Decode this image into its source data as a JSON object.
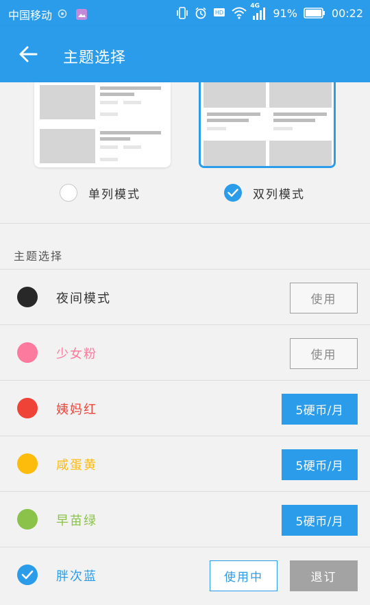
{
  "status_bar": {
    "carrier": "中国移动",
    "network": "4G",
    "battery": "91%",
    "time": "00:22"
  },
  "app_bar": {
    "back_icon": "arrow-left-icon",
    "title": "主题选择"
  },
  "layout_modes": [
    {
      "label": "单列模式",
      "selected": false
    },
    {
      "label": "双列模式",
      "selected": true
    }
  ],
  "section_title": "主题选择",
  "themes": [
    {
      "name": "夜间模式",
      "color": "#282828",
      "text_color": "#333333",
      "action": "使用",
      "action_type": "use"
    },
    {
      "name": "少女粉",
      "color": "#fb7a9e",
      "text_color": "#fb7a9e",
      "action": "使用",
      "action_type": "use"
    },
    {
      "name": "姨妈红",
      "color": "#f04337",
      "text_color": "#f04337",
      "action": "5硬币/月",
      "action_type": "buy"
    },
    {
      "name": "咸蛋黄",
      "color": "#fdbb0b",
      "text_color": "#fdbb0b",
      "action": "5硬币/月",
      "action_type": "buy"
    },
    {
      "name": "早苗绿",
      "color": "#8bc34a",
      "text_color": "#8bc34a",
      "action": "5硬币/月",
      "action_type": "buy"
    },
    {
      "name": "胖次蓝",
      "color": "#2b9cea",
      "text_color": "#2b9cea",
      "action": "使用中",
      "secondary": "退订",
      "action_type": "current"
    }
  ],
  "colors": {
    "accent": "#2b9cea",
    "background": "#f2f2f2"
  }
}
